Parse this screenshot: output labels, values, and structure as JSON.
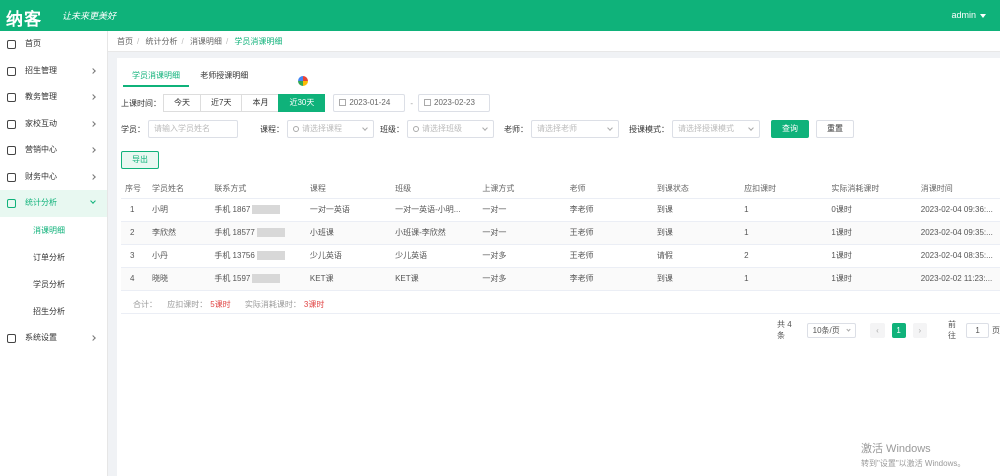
{
  "header": {
    "logo": "纳客",
    "slogan": "让未来更美好",
    "user": "admin"
  },
  "sidebar": {
    "items": [
      {
        "label": "首页",
        "icon": "home-icon"
      },
      {
        "label": "招生管理",
        "icon": "calendar-icon"
      },
      {
        "label": "教务管理",
        "icon": "book-icon"
      },
      {
        "label": "家校互动",
        "icon": "message-icon"
      },
      {
        "label": "营销中心",
        "icon": "compass-icon"
      },
      {
        "label": "财务中心",
        "icon": "wallet-icon"
      },
      {
        "label": "统计分析",
        "icon": "chart-icon"
      }
    ],
    "subitems": [
      "消课明细",
      "订单分析",
      "学员分析",
      "招生分析"
    ],
    "last": {
      "label": "系统设置",
      "icon": "gear-icon"
    }
  },
  "breadcrumb": [
    "首页",
    "统计分析",
    "消课明细",
    "学员消课明细"
  ],
  "tabs": [
    "学员消课明细",
    "老师授课明细"
  ],
  "filters": {
    "time_label": "上课时间：",
    "time_buttons": [
      "今天",
      "近7天",
      "本月",
      "近30天"
    ],
    "date_start": "2023-01-24",
    "date_end": "2023-02-23",
    "student_label": "学员：",
    "student_placeholder": "请输入学员姓名",
    "course_label": "课程：",
    "course_placeholder": "请选择课程",
    "class_label": "班级：",
    "class_placeholder": "请选择班级",
    "teacher_label": "老师：",
    "teacher_placeholder": "请选择老师",
    "mode_label": "授课模式：",
    "mode_placeholder": "请选择授课模式",
    "search_btn": "查询",
    "reset_btn": "重置",
    "export_btn": "导出"
  },
  "table": {
    "headers": [
      "序号",
      "学员姓名",
      "联系方式",
      "课程",
      "班级",
      "上课方式",
      "老师",
      "到课状态",
      "应扣课时",
      "实际消耗课时",
      "消课时间"
    ],
    "rows": [
      [
        "1",
        "小明",
        "手机 1867",
        "一对一英语",
        "一对一英语-小明...",
        "一对一",
        "李老师",
        "到课",
        "1",
        "0课时",
        "2023-02-04 09:36:..."
      ],
      [
        "2",
        "李欣然",
        "手机 18577",
        "小班课",
        "小班课-李欣然",
        "一对一",
        "王老师",
        "到课",
        "1",
        "1课时",
        "2023-02-04 09:35:..."
      ],
      [
        "3",
        "小丹",
        "手机 13756",
        "少儿英语",
        "少儿英语",
        "一对多",
        "王老师",
        "请假",
        "2",
        "1课时",
        "2023-02-04 08:35:..."
      ],
      [
        "4",
        "晓晓",
        "手机 1597",
        "KET课",
        "KET课",
        "一对多",
        "李老师",
        "到课",
        "1",
        "1课时",
        "2023-02-02 11:23:..."
      ]
    ],
    "summary": {
      "total_label": "合计：",
      "due_label": "应扣课时：",
      "due_value": "5课时",
      "actual_label": "实际消耗课时：",
      "actual_value": "3课时"
    }
  },
  "pagination": {
    "total": "共 4 条",
    "page_size": "10条/页",
    "current": "1",
    "goto_label": "前往",
    "goto_value": "1",
    "page_unit": "页"
  },
  "watermark": {
    "line1": "激活 Windows",
    "line2": "转到\"设置\"以激活 Windows。"
  }
}
